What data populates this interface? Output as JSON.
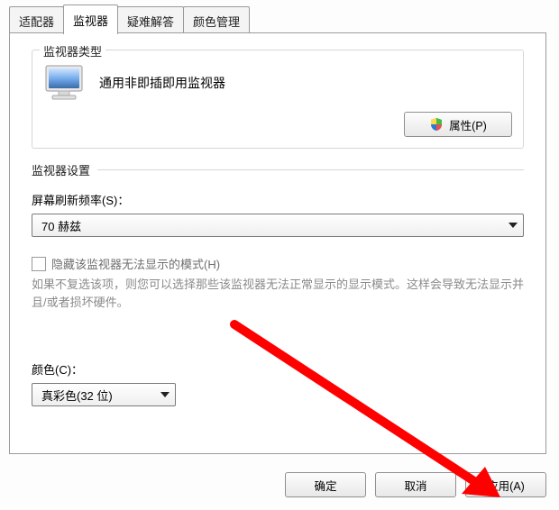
{
  "tabs": {
    "adapter": "适配器",
    "monitor": "监视器",
    "troubleshoot": "疑难解答",
    "color": "颜色管理"
  },
  "group_monitor_type": {
    "title": "监视器类型",
    "monitor_name": "通用非即插即用监视器",
    "properties_btn": "属性(P)"
  },
  "group_settings": {
    "title": "监视器设置",
    "refresh_label": "屏幕刷新频率(S)：",
    "refresh_value": "70 赫兹",
    "hide_modes_label": "隐藏该监视器无法显示的模式(H)",
    "helper": "如果不复选该项，则您可以选择那些该监视器无法正常显示的显示模式。这样会导致无法显示并且/或者损坏硬件。",
    "color_label": "颜色(C)：",
    "color_value": "真彩色(32 位)"
  },
  "buttons": {
    "ok": "确定",
    "cancel": "取消",
    "apply": "应用(A)"
  }
}
